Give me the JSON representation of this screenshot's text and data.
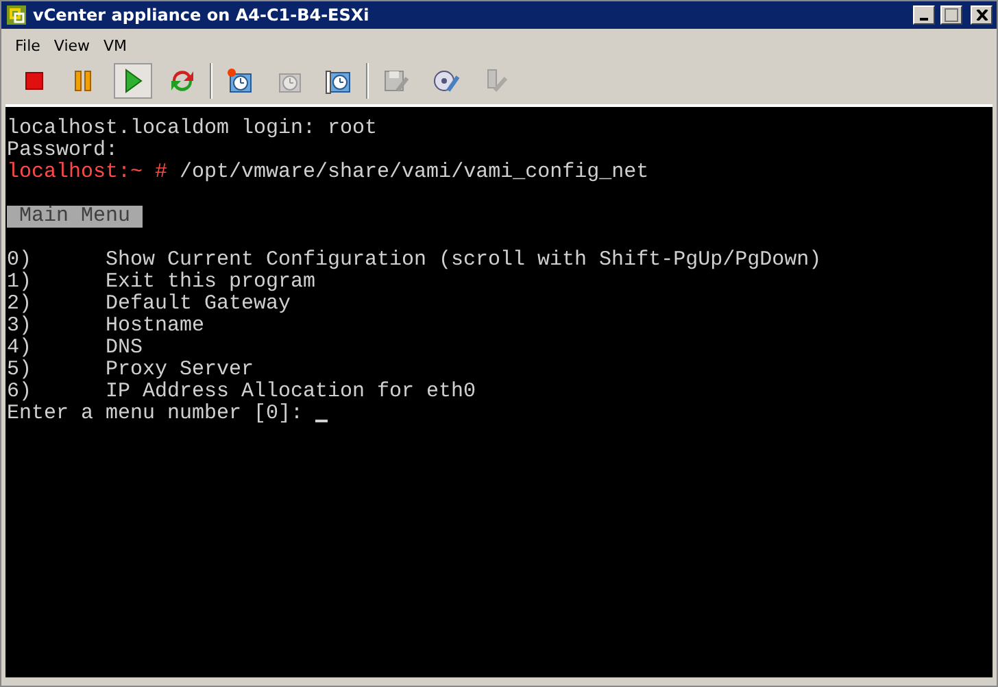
{
  "window": {
    "title": "vCenter appliance on A4-C1-B4-ESXi"
  },
  "menu": [
    "File",
    "View",
    "VM"
  ],
  "toolbar": {
    "groups": [
      [
        {
          "kind": "stop",
          "selected": false,
          "disabled": false
        },
        {
          "kind": "pause",
          "selected": false,
          "disabled": false
        },
        {
          "kind": "play",
          "selected": true,
          "disabled": false
        },
        {
          "kind": "reset",
          "selected": false,
          "disabled": false
        }
      ],
      [
        {
          "kind": "snapshot",
          "selected": false,
          "disabled": false
        },
        {
          "kind": "revert",
          "selected": false,
          "disabled": true
        },
        {
          "kind": "manage",
          "selected": false,
          "disabled": false
        }
      ],
      [
        {
          "kind": "floppy",
          "selected": false,
          "disabled": true
        },
        {
          "kind": "cd",
          "selected": false,
          "disabled": false
        },
        {
          "kind": "usb",
          "selected": false,
          "disabled": true
        }
      ]
    ]
  },
  "console": {
    "lines": [
      {
        "kind": "text",
        "text": "localhost.localdom login: root"
      },
      {
        "kind": "text",
        "text": "Password:"
      },
      {
        "kind": "prompt",
        "prompt": "localhost:~ #",
        "text": "/opt/vmware/share/vami/vami_config_net"
      },
      {
        "kind": "blank"
      },
      {
        "kind": "header",
        "text": "Main Menu"
      },
      {
        "kind": "blank"
      },
      {
        "kind": "item",
        "number": "0)",
        "text": "Show Current Configuration (scroll with Shift-PgUp/PgDown)"
      },
      {
        "kind": "item",
        "number": "1)",
        "text": "Exit this program"
      },
      {
        "kind": "item",
        "number": "2)",
        "text": "Default Gateway"
      },
      {
        "kind": "item",
        "number": "3)",
        "text": "Hostname"
      },
      {
        "kind": "item",
        "number": "4)",
        "text": "DNS"
      },
      {
        "kind": "item",
        "number": "5)",
        "text": "Proxy Server"
      },
      {
        "kind": "item",
        "number": "6)",
        "text": "IP Address Allocation for eth0"
      },
      {
        "kind": "input",
        "text": "Enter a menu number [0]:"
      }
    ]
  }
}
